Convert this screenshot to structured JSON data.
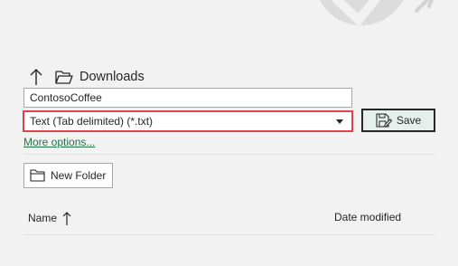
{
  "navigation": {
    "up_icon": "arrow-up-icon",
    "folder_icon": "folder-open-icon",
    "location": "Downloads"
  },
  "file_name": {
    "value": "ContosoCoffee"
  },
  "file_type": {
    "selected": "Text (Tab delimited) (*.txt)",
    "highlight_color": "#e2434a"
  },
  "save_button": {
    "label": "Save",
    "icon": "save-as-icon"
  },
  "more_options": {
    "label": "More options..."
  },
  "new_folder": {
    "label": "New Folder",
    "icon": "folder-icon"
  },
  "file_list": {
    "columns": [
      "Name",
      "Date modified"
    ],
    "sort_icon": "sort-ascending-arrow-icon"
  },
  "colors": {
    "accent": "#217346",
    "background": "#f2f2f2",
    "save_button_bg": "#e5f0ed"
  }
}
